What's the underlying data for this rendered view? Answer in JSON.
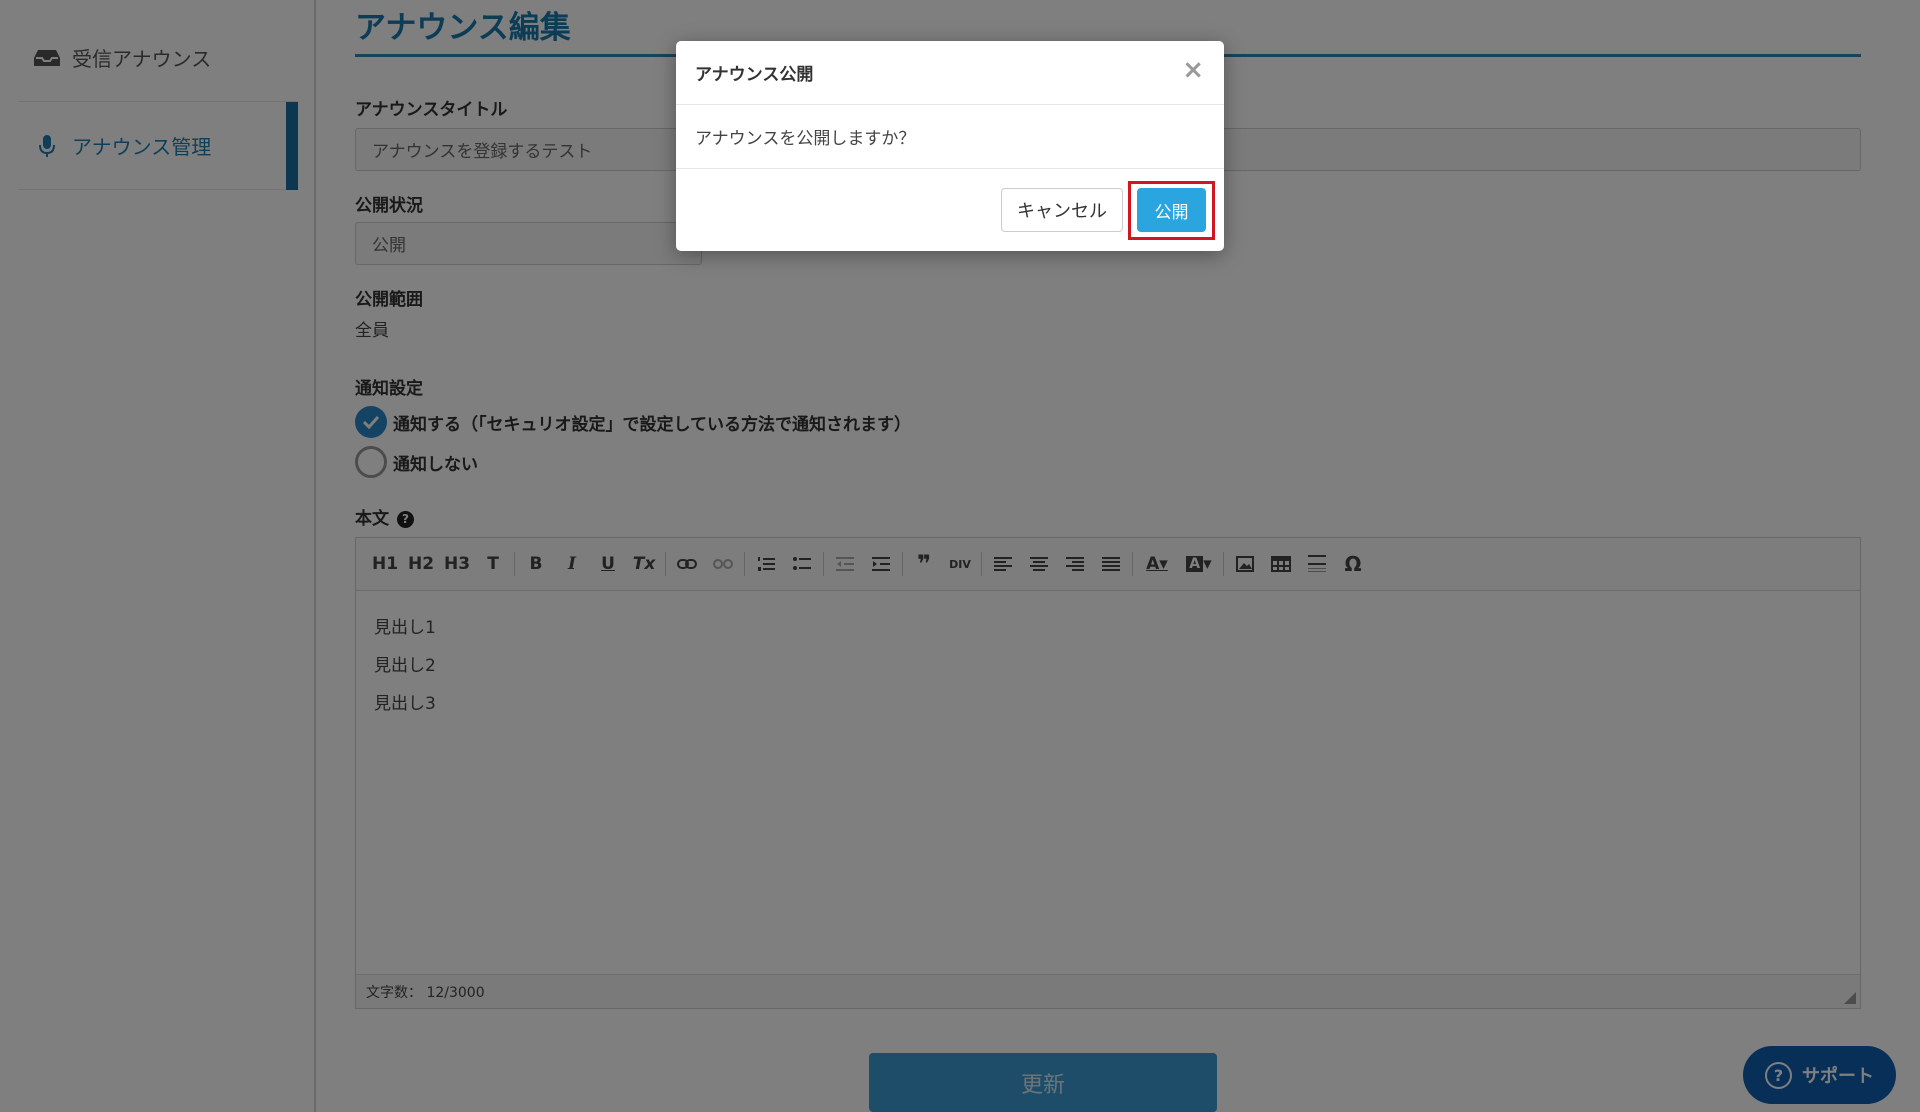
{
  "sidebar": {
    "items": [
      {
        "label": "受信アナウンス",
        "icon": "inbox-icon"
      },
      {
        "label": "アナウンス管理",
        "icon": "microphone-icon"
      }
    ]
  },
  "main": {
    "title": "アナウンス編集",
    "announce_title_label": "アナウンスタイトル",
    "announce_title_value": "アナウンスを登録するテスト",
    "status_label": "公開状況",
    "status_value": "公開",
    "scope_label": "公開範囲",
    "scope_value": "全員",
    "notify_label": "通知設定",
    "notify_options": [
      {
        "label": "通知する（「セキュリオ設定」で設定している方法で通知されます）",
        "checked": true
      },
      {
        "label": "通知しない",
        "checked": false
      }
    ],
    "body_label": "本文",
    "editor": {
      "toolbar": [
        "H1",
        "H2",
        "H3",
        "T",
        "B",
        "I",
        "U",
        "Tx"
      ],
      "lines": [
        "見出し1",
        "見出し2",
        "見出し3"
      ],
      "char_count": "文字数： 12/3000"
    },
    "update_button": "更新"
  },
  "support_button": "サポート",
  "modal": {
    "title": "アナウンス公開",
    "message": "アナウンスを公開しますか？",
    "cancel_label": "キャンセル",
    "publish_label": "公開"
  },
  "colors": {
    "accent": "#1b78ae",
    "publish_button": "#2aa5df",
    "highlight_border": "#d2151f",
    "support": "#0f5fae"
  }
}
